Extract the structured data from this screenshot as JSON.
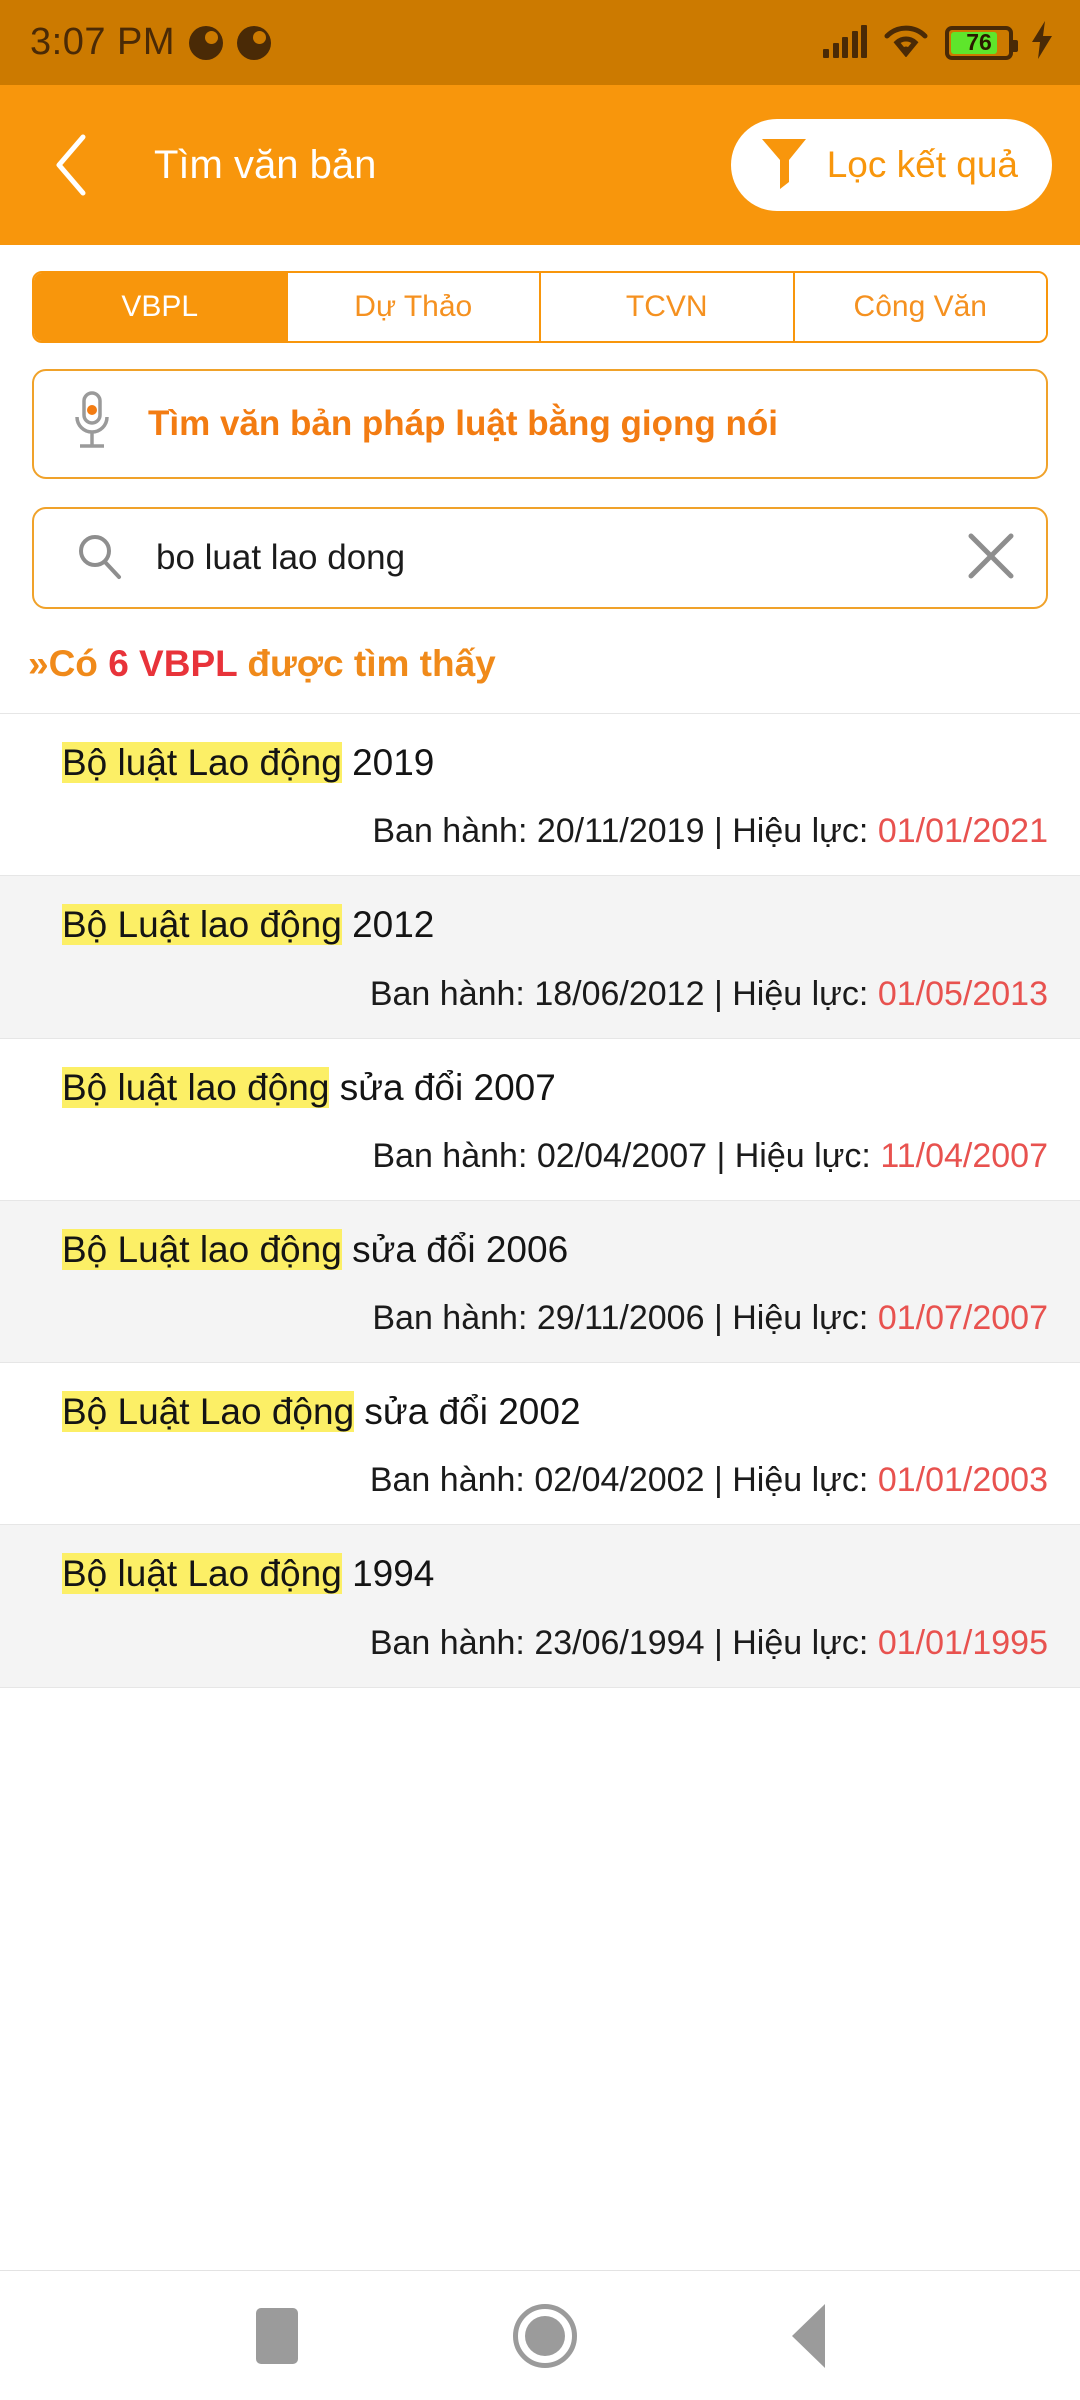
{
  "status_bar": {
    "time": "3:07 PM",
    "battery_percent": "76",
    "icons": [
      "notification-dot-icon",
      "notification-dot-icon",
      "signal-icon",
      "wifi-icon",
      "battery-icon",
      "charging-bolt-icon"
    ],
    "background_color": "#cc7a00",
    "foreground_color": "#4a2a06",
    "battery_fill_color": "#5ee62b"
  },
  "app_bar": {
    "back_label": "back-chevron",
    "title": "Tìm văn bản",
    "filter_label": "Lọc kết quả",
    "background_color": "#f8960c"
  },
  "tabs": {
    "items": [
      {
        "label": "VBPL",
        "active": true
      },
      {
        "label": "Dự Thảo",
        "active": false
      },
      {
        "label": "TCVN",
        "active": false
      },
      {
        "label": "Công Văn",
        "active": false
      }
    ],
    "accent_color": "#f8960c"
  },
  "voice_search": {
    "label": "Tìm văn bản pháp luật bằng giọng nói",
    "icon": "microphone-icon",
    "text_color": "#f37c12"
  },
  "search": {
    "value": "bo luat lao dong",
    "placeholder": "bo luat lao dong",
    "search_icon": "search-icon",
    "clear_icon": "close-icon"
  },
  "result_count": {
    "prefix": "»Có ",
    "highlight": "6 VBPL",
    "suffix": " được tìm thấy",
    "count": 6,
    "prefix_color": "#f08a1a",
    "highlight_color": "#e8333a"
  },
  "meta_labels": {
    "issued": "Ban hành: ",
    "separator": " | ",
    "effective": "Hiệu lực: ",
    "effective_color": "#e8524f",
    "highlight_color": "#fcef66"
  },
  "results": [
    {
      "highlight": "Bộ luật Lao động",
      "rest": " 2019",
      "issued_date": "20/11/2019",
      "effective_date": "01/01/2021"
    },
    {
      "highlight": "Bộ Luật lao động",
      "rest": " 2012",
      "issued_date": "18/06/2012",
      "effective_date": "01/05/2013"
    },
    {
      "highlight": "Bộ luật lao động",
      "rest": " sửa đổi 2007",
      "issued_date": "02/04/2007",
      "effective_date": "11/04/2007"
    },
    {
      "highlight": "Bộ Luật lao động",
      "rest": " sửa đổi 2006",
      "issued_date": "29/11/2006",
      "effective_date": "01/07/2007"
    },
    {
      "highlight": "Bộ Luật Lao động",
      "rest": " sửa đổi 2002",
      "issued_date": "02/04/2002",
      "effective_date": "01/01/2003"
    },
    {
      "highlight": "Bộ luật Lao động",
      "rest": " 1994",
      "issued_date": "23/06/1994",
      "effective_date": "01/01/1995"
    }
  ],
  "nav_bar": {
    "items": [
      {
        "name": "recents-button",
        "icon": "square-icon"
      },
      {
        "name": "home-button",
        "icon": "circle-icon"
      },
      {
        "name": "back-button",
        "icon": "triangle-left-icon"
      }
    ],
    "icon_color": "#9b9b9b"
  }
}
